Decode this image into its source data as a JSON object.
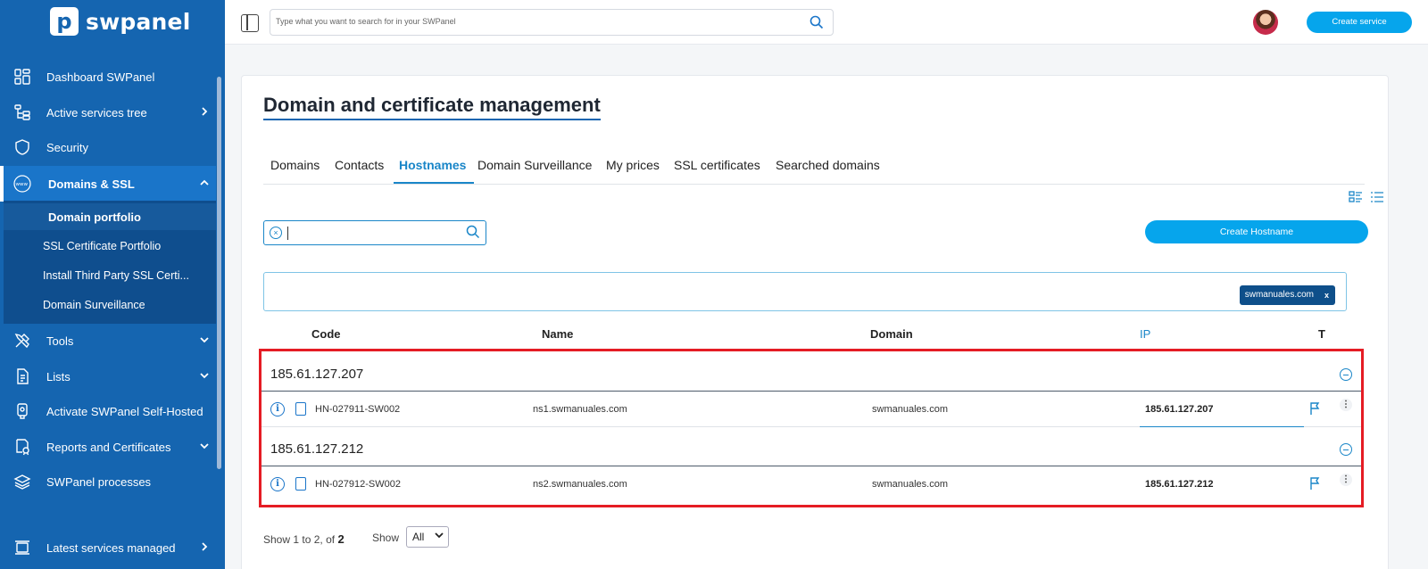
{
  "brand": {
    "name": "swpanel",
    "logo_letter": "p"
  },
  "sidebar": {
    "items": [
      {
        "label": "Dashboard SWPanel",
        "icon": "dashboard-icon"
      },
      {
        "label": "Active services tree",
        "icon": "tree-icon"
      },
      {
        "label": "Security",
        "icon": "shield-icon"
      },
      {
        "label": "Domains & SSL",
        "icon": "www-icon"
      },
      {
        "label": "Tools",
        "icon": "tools-icon"
      },
      {
        "label": "Lists",
        "icon": "list-icon"
      },
      {
        "label": "Activate SWPanel Self-Hosted",
        "icon": "self-hosted-icon"
      },
      {
        "label": "Reports and Certificates",
        "icon": "certificate-icon"
      },
      {
        "label": "SWPanel processes",
        "icon": "layers-icon"
      },
      {
        "label": "Latest services managed",
        "icon": "history-icon"
      }
    ],
    "subitems": [
      {
        "label": "Domain portfolio"
      },
      {
        "label": "SSL Certificate Portfolio"
      },
      {
        "label": "Install Third Party SSL Certi..."
      },
      {
        "label": "Domain Surveillance"
      }
    ]
  },
  "topbar": {
    "search_placeholder": "Type what you want to search for in your SWPanel",
    "create_service": "Create service"
  },
  "main": {
    "title": "Domain and certificate management",
    "tabs": [
      {
        "label": "Domains"
      },
      {
        "label": "Contacts"
      },
      {
        "label": "Hostnames"
      },
      {
        "label": "Domain Surveillance"
      },
      {
        "label": "My prices"
      },
      {
        "label": "SSL certificates"
      },
      {
        "label": "Searched domains"
      }
    ],
    "active_tab": "Hostnames",
    "create_hostname": "Create Hostname",
    "filter_chip": "swmanuales.com",
    "filter_chip_close": "x",
    "columns": {
      "code": "Code",
      "name": "Name",
      "domain": "Domain",
      "ip": "IP",
      "t": "T"
    },
    "groups": [
      {
        "ip": "185.61.127.207",
        "row": {
          "code": "HN-027911-SW002",
          "name": "ns1.swmanuales.com",
          "domain": "swmanuales.com",
          "ip": "185.61.127.207"
        }
      },
      {
        "ip": "185.61.127.212",
        "row": {
          "code": "HN-027912-SW002",
          "name": "ns2.swmanuales.com",
          "domain": "swmanuales.com",
          "ip": "185.61.127.212"
        }
      }
    ],
    "pager": {
      "prefix": "Show ",
      "from": "1",
      "mid": " to ",
      "to": "2",
      "of": ", of ",
      "total": "2"
    },
    "show_label": "Show",
    "show_value": "All"
  },
  "colors": {
    "sidebar": "#1565b0",
    "accent": "#06a5ec",
    "highlight_frame": "#e51c24"
  }
}
